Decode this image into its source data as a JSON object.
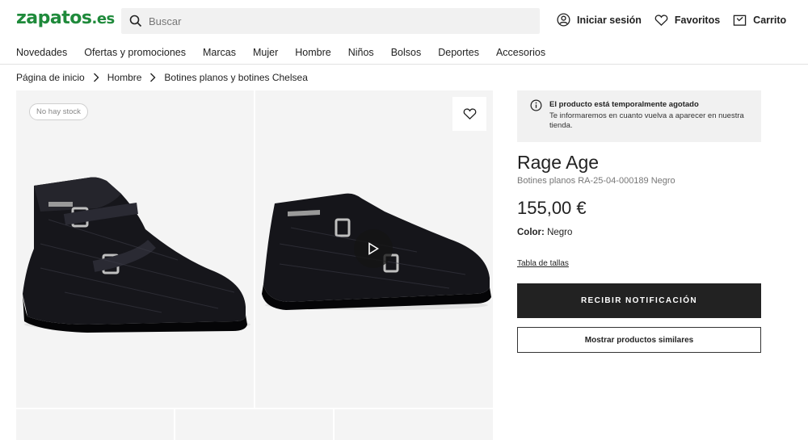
{
  "header": {
    "logo_main": "zapatos",
    "logo_tld": ".es",
    "search_placeholder": "Buscar",
    "actions": {
      "login": "Iniciar sesión",
      "favorites": "Favoritos",
      "cart": "Carrito"
    },
    "brand_color": "#1f8a3b"
  },
  "nav": {
    "items": [
      "Novedades",
      "Ofertas y promociones",
      "Marcas",
      "Mujer",
      "Hombre",
      "Niños",
      "Bolsos",
      "Deportes",
      "Accesorios"
    ]
  },
  "breadcrumb": [
    "Página de inicio",
    "Hombre",
    "Botines planos y botines Chelsea"
  ],
  "gallery": {
    "stock_badge": "No hay stock",
    "icons": [
      "heart-icon",
      "play-icon"
    ]
  },
  "product": {
    "alert_title": "El producto está temporalmente agotado",
    "alert_text": "Te informaremos en cuanto vuelva a aparecer en nuestra tienda.",
    "brand": "Rage Age",
    "subtitle": "Botines planos RA-25-04-000189 Negro",
    "price": "155,00 €",
    "color_label": "Color:",
    "color_value": "Negro",
    "size_table_link": "Tabla de tallas",
    "notify_button": "RECIBIR NOTIFICACIÓN",
    "similar_button": "Mostrar productos similares"
  }
}
